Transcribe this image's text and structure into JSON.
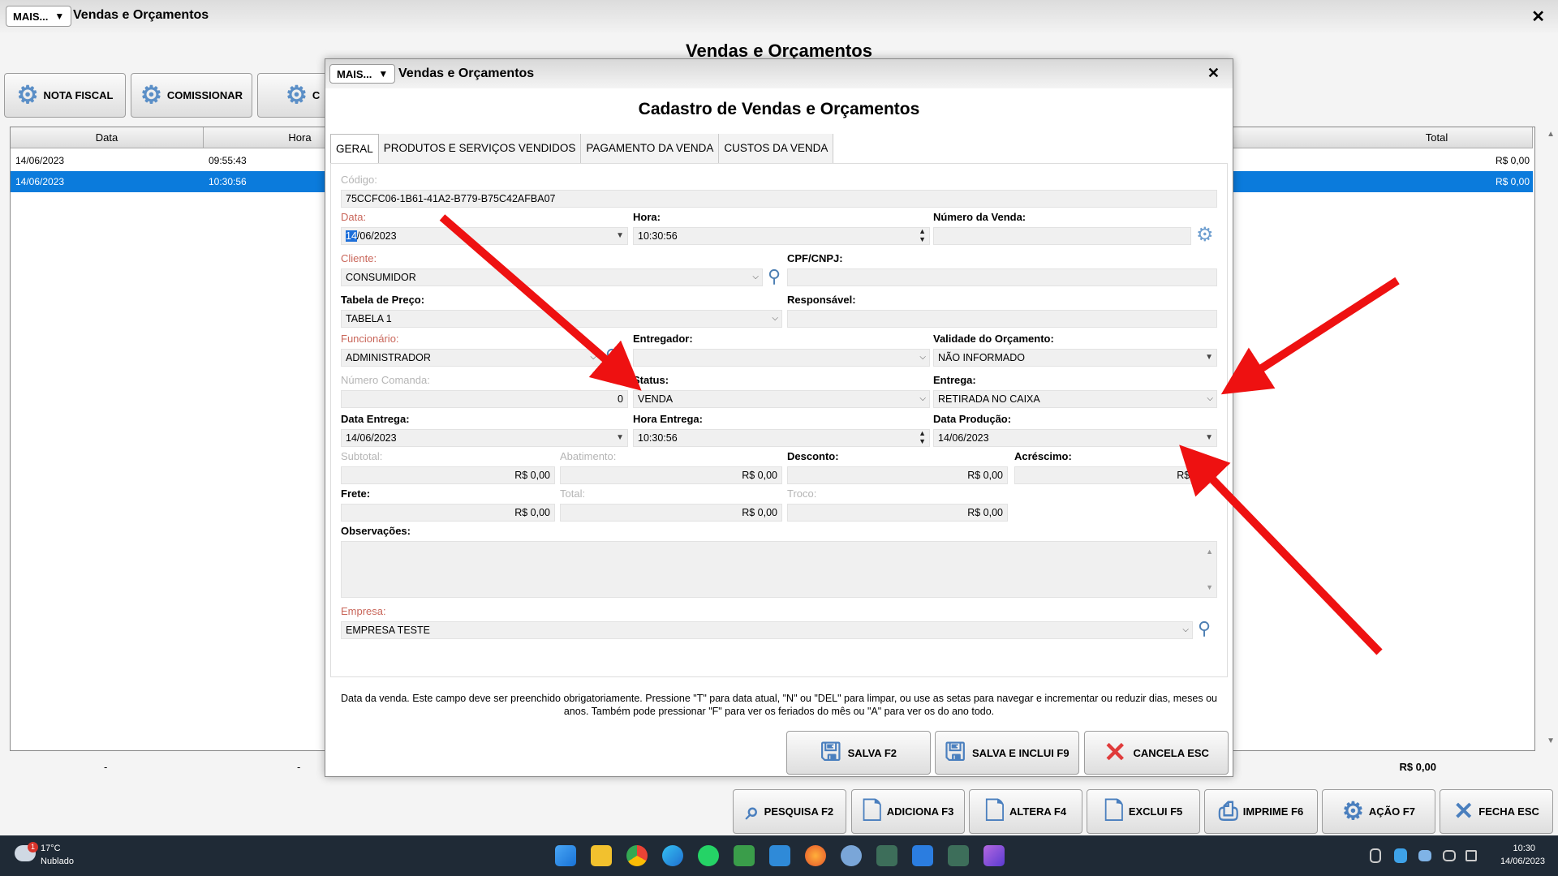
{
  "app": {
    "mais_label": "MAIS...",
    "title": "Vendas e Orçamentos",
    "close": "✕",
    "page_title": "Vendas e Orçamentos",
    "toolbar": [
      "NOTA FISCAL",
      "COMISSIONAR",
      "C"
    ],
    "grid": {
      "headers": [
        "Data",
        "Hora",
        "Total"
      ],
      "rows": [
        {
          "data": "14/06/2023",
          "hora": "09:55:43",
          "total": "R$ 0,00"
        },
        {
          "data": "14/06/2023",
          "hora": "10:30:56",
          "total": "R$ 0,00"
        }
      ],
      "footer_left_1": "-",
      "footer_left_2": "-",
      "footer_total": "R$ 0,00"
    },
    "bottom_buttons": [
      "PESQUISA F2",
      "ADICIONA F3",
      "ALTERA F4",
      "EXCLUI F5",
      "IMPRIME F6",
      "AÇÃO F7",
      "FECHA ESC"
    ]
  },
  "dialog": {
    "mais_label": "MAIS...",
    "title": "Vendas e Orçamentos",
    "close": "✕",
    "heading": "Cadastro de Vendas e Orçamentos",
    "tabs": [
      "GERAL",
      "PRODUTOS E SERVIÇOS VENDIDOS",
      "PAGAMENTO DA VENDA",
      "CUSTOS DA VENDA"
    ],
    "fields": {
      "codigo_label": "Código:",
      "codigo": "75CCFC06-1B61-41A2-B779-B75C42AFBA07",
      "data_label": "Data:",
      "data_sel": "14",
      "data_rest": "/06/2023",
      "hora_label": "Hora:",
      "hora": "10:30:56",
      "numero_venda_label": "Número da Venda:",
      "numero_venda": "",
      "cliente_label": "Cliente:",
      "cliente": "CONSUMIDOR",
      "cpf_label": "CPF/CNPJ:",
      "cpf": "",
      "tabela_label": "Tabela de Preço:",
      "tabela": "TABELA 1",
      "responsavel_label": "Responsável:",
      "responsavel": "",
      "funcionario_label": "Funcionário:",
      "funcionario": "ADMINISTRADOR",
      "entregador_label": "Entregador:",
      "entregador": "",
      "validade_label": "Validade do Orçamento:",
      "validade": "NÃO INFORMADO",
      "comanda_label": "Número Comanda:",
      "comanda": "0",
      "status_label": "Status:",
      "status": "VENDA",
      "entrega_label": "Entrega:",
      "entrega": "RETIRADA NO CAIXA",
      "data_entrega_label": "Data Entrega:",
      "data_entrega": "14/06/2023",
      "hora_entrega_label": "Hora Entrega:",
      "hora_entrega": "10:30:56",
      "data_producao_label": "Data Produção:",
      "data_producao": "14/06/2023",
      "subtotal_label": "Subtotal:",
      "subtotal": "R$ 0,00",
      "abatimento_label": "Abatimento:",
      "abatimento": "R$ 0,00",
      "desconto_label": "Desconto:",
      "desconto": "R$ 0,00",
      "acrescimo_label": "Acréscimo:",
      "acrescimo": "R$ 0,00",
      "frete_label": "Frete:",
      "frete": "R$ 0,00",
      "total_label": "Total:",
      "total": "R$ 0,00",
      "troco_label": "Troco:",
      "troco": "R$ 0,00",
      "obs_label": "Observações:",
      "empresa_label": "Empresa:",
      "empresa": "EMPRESA TESTE"
    },
    "help_text": "Data da venda. Este campo deve ser preenchido obrigatoriamente. Pressione \"T\" para data atual, \"N\" ou \"DEL\" para limpar, ou use as setas para navegar e incrementar ou reduzir dias, meses ou anos. Também pode pressionar \"F\" para ver os feriados do mês ou \"A\" para ver os do ano todo.",
    "buttons": [
      "SALVA F2",
      "SALVA E INCLUI F9",
      "CANCELA ESC"
    ]
  },
  "taskbar": {
    "weather_temp": "17°C",
    "weather_desc": "Nublado",
    "weather_badge": "1",
    "time": "10:30",
    "date": "14/06/2023"
  },
  "colors": {
    "selection": "#0b7bdc",
    "required_label": "#c9665a",
    "arrow": "#ee1111",
    "taskbar": "#1f2a36"
  }
}
